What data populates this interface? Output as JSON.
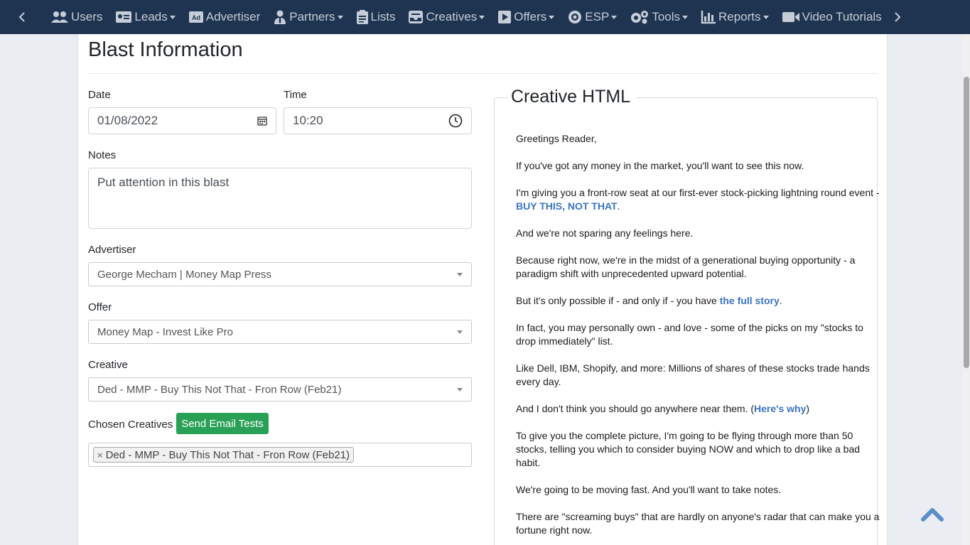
{
  "nav": {
    "items": [
      {
        "label": "Users",
        "icon": "users-icon",
        "caret": false
      },
      {
        "label": "Leads",
        "icon": "id-card-icon",
        "caret": true
      },
      {
        "label": "Advertiser",
        "icon": "ad-icon",
        "caret": false
      },
      {
        "label": "Partners",
        "icon": "user-tie-icon",
        "caret": true
      },
      {
        "label": "Lists",
        "icon": "clipboard-list-icon",
        "caret": false
      },
      {
        "label": "Creatives",
        "icon": "inbox-icon",
        "caret": true
      },
      {
        "label": "Offers",
        "icon": "play-square-icon",
        "caret": true
      },
      {
        "label": "ESP",
        "icon": "mail-bulk-icon",
        "caret": true
      },
      {
        "label": "Tools",
        "icon": "cogs-icon",
        "caret": true
      },
      {
        "label": "Reports",
        "icon": "chart-bar-icon",
        "caret": true
      },
      {
        "label": "Video Tutorials",
        "icon": "video-icon",
        "caret": false
      }
    ]
  },
  "page": {
    "title": "Blast Information"
  },
  "form": {
    "date_label": "Date",
    "date_value": "01/08/2022",
    "time_label": "Time",
    "time_value": "10:20",
    "notes_label": "Notes",
    "notes_value": "Put attention in this blast",
    "advertiser_label": "Advertiser",
    "advertiser_value": "George Mecham | Money Map Press",
    "offer_label": "Offer",
    "offer_value": "Money Map - Invest Like Pro",
    "creative_label": "Creative",
    "creative_value": "Ded - MMP - Buy This Not That - Fron Row (Feb21)",
    "chosen_label": "Chosen Creatives",
    "send_tests_label": "Send Email Tests",
    "chosen_tag": "Ded - MMP - Buy This Not That - Fron Row (Feb21)",
    "tag_remove": "×"
  },
  "creative_html": {
    "legend": "Creative HTML",
    "p1": "Greetings Reader,",
    "p2": "If you've got any money in the market, you'll want to see this now.",
    "p3_text": "I'm giving you a front-row seat at our first-ever stock-picking lightning round event - ",
    "p3_link": "BUY THIS, NOT THAT",
    "p3_end": ".",
    "p4": "And we're not sparing any feelings here.",
    "p5": "Because right now, we're in the midst of a generational buying opportunity - a paradigm shift with unprecedented upward potential.",
    "p6_text": "But it's only possible if - and only if - you have ",
    "p6_link": "the full story",
    "p6_end": ".",
    "p7": "In fact, you may personally own - and love - some of the picks on my \"stocks to drop immediately\" list.",
    "p8": "Like Dell, IBM, Shopify, and more: Millions of shares of these stocks trade hands every day.",
    "p9_text": "And I don't think you should go anywhere near them. (",
    "p9_link": "Here's why",
    "p9_end": ")",
    "p10": "To give you the complete picture, I'm going to be flying through more than 50 stocks, telling you which to consider buying NOW and which to drop like a bad habit.",
    "p11": "We're going to be moving fast. And you'll want to take notes.",
    "p12": "There are \"screaming buys\" that are hardly on anyone's radar that can make you a fortune right now."
  },
  "colors": {
    "nav_bg": "#1f3450",
    "accent_green": "#28a055",
    "link_blue": "#3a74c2",
    "back_to_top": "#5b8fc7"
  }
}
